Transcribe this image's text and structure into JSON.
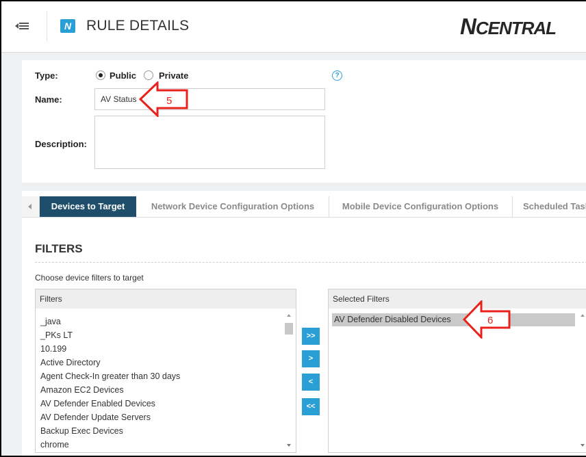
{
  "header": {
    "title": "RULE DETAILS",
    "logo_big": "N",
    "logo_rest": "CENTRAL",
    "app_icon_letter": "N"
  },
  "form": {
    "type_label": "Type:",
    "public_label": "Public",
    "private_label": "Private",
    "type_selected": "Public",
    "name_label": "Name:",
    "name_value": "AV Status",
    "description_label": "Description:",
    "description_value": "",
    "help_glyph": "?"
  },
  "tabs": [
    {
      "label": "Devices to Target",
      "active": true
    },
    {
      "label": "Network Device Configuration Options",
      "active": false
    },
    {
      "label": "Mobile Device Configuration Options",
      "active": false
    },
    {
      "label": "Scheduled Tasks",
      "active": false
    }
  ],
  "filters_section": {
    "heading": "FILTERS",
    "instruction": "Choose device filters to target",
    "available_header": "Filters",
    "selected_header": "Selected Filters",
    "available_items": [
      "_java",
      "_PKs LT",
      "10.199",
      "Active Directory",
      "Agent Check-In greater than 30 days",
      "Amazon EC2 Devices",
      "AV Defender Enabled Devices",
      "AV Defender Update Servers",
      "Backup Exec Devices",
      "chrome"
    ],
    "selected_items": [
      "AV Defender Disabled Devices"
    ],
    "buttons": {
      "add_all": ">>",
      "add": ">",
      "remove": "<",
      "remove_all": "<<"
    }
  },
  "annotations": {
    "callout_5": "5",
    "callout_6": "6",
    "callout_color": "#e8221b"
  },
  "colors": {
    "accent": "#2a9fd6",
    "active_tab": "#1f4e6b"
  }
}
